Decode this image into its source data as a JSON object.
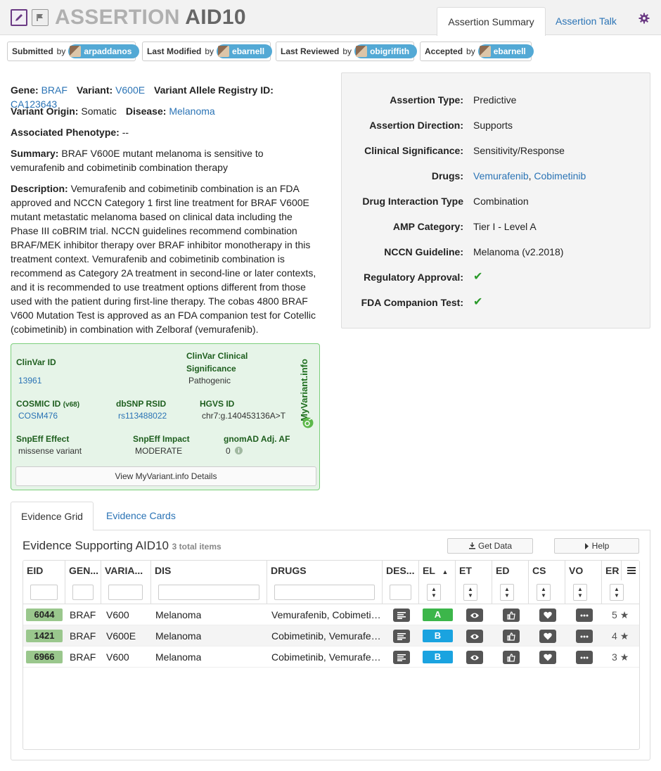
{
  "header": {
    "title_prefix": "ASSERTION",
    "title_id": "AID10",
    "tabs": [
      {
        "label": "Assertion Summary",
        "active": true
      },
      {
        "label": "Assertion Talk",
        "active": false
      }
    ]
  },
  "attributions": [
    {
      "label": "Submitted",
      "by": "by",
      "user": "arpaddanos"
    },
    {
      "label": "Last Modified",
      "by": "by",
      "user": "ebarnell"
    },
    {
      "label": "Last Reviewed",
      "by": "by",
      "user": "obigriffith"
    },
    {
      "label": "Accepted",
      "by": "by",
      "user": "ebarnell"
    }
  ],
  "summary": {
    "gene_label": "Gene:",
    "gene": "BRAF",
    "variant_label": "Variant:",
    "variant": "V600E",
    "registry_label": "Variant Allele Registry ID:",
    "registry_id": "CA123643",
    "origin_label": "Variant Origin:",
    "origin": "Somatic",
    "disease_label": "Disease:",
    "disease": "Melanoma",
    "phenotype_label": "Associated Phenotype:",
    "phenotype": "--",
    "summary_label": "Summary:",
    "summary_text": "BRAF V600E mutant melanoma is sensitive to vemurafenib and cobimetinib combination therapy",
    "description_label": "Description:",
    "description_text": "Vemurafenib and cobimetinib combination is an FDA approved and NCCN Category 1 first line treatment for BRAF V600E mutant metastatic melanoma based on clinical data including the Phase III coBRIM trial. NCCN guidelines recommend combination BRAF/MEK inhibitor therapy over BRAF inhibitor monotherapy in this treatment context. Vemurafenib and cobimetinib combination is recommend as Category 2A treatment in second-line or later contexts, and it is recommended to use treatment options different from those used with the patient during first-line therapy. The cobas 4800 BRAF V600 Mutation Test is approved as an FDA companion test for Cotellic (cobimetinib) in combination with Zelboraf (vemurafenib)."
  },
  "properties": [
    {
      "label": "Assertion Type:",
      "value": "Predictive"
    },
    {
      "label": "Assertion Direction:",
      "value": "Supports"
    },
    {
      "label": "Clinical Significance:",
      "value": "Sensitivity/Response"
    },
    {
      "label": "Drugs:",
      "drug1": "Vemurafenib",
      "sep": ",",
      "drug2": "Cobimetinib"
    },
    {
      "label": "Drug Interaction Type",
      "value": "Combination"
    },
    {
      "label": "AMP Category:",
      "value": "Tier I - Level A"
    },
    {
      "label": "NCCN Guideline:",
      "value": "Melanoma (v2.2018)"
    },
    {
      "label": "Regulatory Approval:",
      "value": "✔"
    },
    {
      "label": "FDA Companion Test:",
      "value": "✔"
    }
  ],
  "myvariant": {
    "brand": "MyVariant.info",
    "clinvar_id_label": "ClinVar ID",
    "clinvar_id": "13961",
    "clinvar_sig_label": "ClinVar Clinical Significance",
    "clinvar_sig": "Pathogenic",
    "cosmic_label": "COSMIC ID",
    "cosmic_version": "(v68)",
    "cosmic_id": "COSM476",
    "dbsnp_label": "dbSNP RSID",
    "dbsnp": "rs113488022",
    "hgvs_label": "HGVS ID",
    "hgvs": "chr7:g.140453136A>T",
    "snpeff_effect_label": "SnpEff Effect",
    "snpeff_effect": "missense variant",
    "snpeff_impact_label": "SnpEff Impact",
    "snpeff_impact": "MODERATE",
    "gnomad_label": "gnomAD Adj. AF",
    "gnomad": "0",
    "details_button": "View MyVariant.info Details"
  },
  "evidence": {
    "tabs": [
      {
        "label": "Evidence Grid",
        "active": true
      },
      {
        "label": "Evidence Cards",
        "active": false
      }
    ],
    "title": "Evidence Supporting AID10",
    "count": "3 total items",
    "get_data_label": "Get Data",
    "help_label": "Help",
    "columns": [
      "EID",
      "GEN...",
      "VARIA...",
      "DIS",
      "DRUGS",
      "DES...",
      "EL",
      "ET",
      "ED",
      "CS",
      "VO",
      "ER"
    ],
    "sort_indicator": "▲",
    "rows": [
      {
        "eid": "6044",
        "gene": "BRAF",
        "variant": "V600",
        "disease": "Melanoma",
        "drugs": "Vemurafenib, Cobimetinib",
        "el": "A",
        "el_color": "#3cb64a",
        "er": "5"
      },
      {
        "eid": "1421",
        "gene": "BRAF",
        "variant": "V600E",
        "disease": "Melanoma",
        "drugs": "Cobimetinib, Vemurafenib",
        "el": "B",
        "el_color": "#1aa3e0",
        "er": "4"
      },
      {
        "eid": "6966",
        "gene": "BRAF",
        "variant": "V600",
        "disease": "Melanoma",
        "drugs": "Cobimetinib, Vemurafenib",
        "el": "B",
        "el_color": "#1aa3e0",
        "er": "3"
      }
    ],
    "star": "★"
  },
  "colors": {
    "accent": "#6b3a84",
    "link": "#2a73b5",
    "user_badge": "#53a9d5",
    "eid_badge": "#9ac78d",
    "check": "#2a9a2a"
  }
}
